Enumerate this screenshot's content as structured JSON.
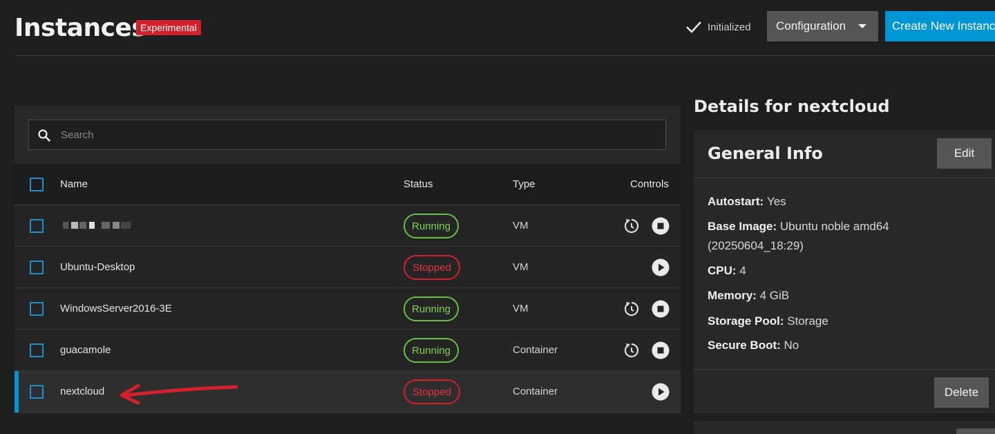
{
  "header": {
    "title": "Instances",
    "badge": "Experimental",
    "status": "Initialized",
    "config_button": "Configuration",
    "create_button": "Create New Instance"
  },
  "search": {
    "placeholder": "Search"
  },
  "table": {
    "columns": {
      "name": "Name",
      "status": "Status",
      "type": "Type",
      "controls": "Controls"
    },
    "rows": [
      {
        "name": "",
        "status": "Running",
        "type": "VM",
        "controls": [
          "restart",
          "stop"
        ],
        "name_obscured": true
      },
      {
        "name": "Ubuntu-Desktop",
        "status": "Stopped",
        "type": "VM",
        "controls": [
          "start"
        ]
      },
      {
        "name": "WindowsServer2016-3E",
        "status": "Running",
        "type": "VM",
        "controls": [
          "restart",
          "stop"
        ]
      },
      {
        "name": "guacamole",
        "status": "Running",
        "type": "Container",
        "controls": [
          "restart",
          "stop"
        ]
      },
      {
        "name": "nextcloud",
        "status": "Stopped",
        "type": "Container",
        "controls": [
          "start"
        ],
        "selected": true
      }
    ]
  },
  "details": {
    "title": "Details for nextcloud",
    "card_title": "General Info",
    "edit_button": "Edit",
    "delete_button": "Delete",
    "info": [
      {
        "label": "Autostart:",
        "value": "Yes"
      },
      {
        "label": "Base Image:",
        "value": "Ubuntu noble amd64"
      },
      {
        "label": "",
        "value": "(20250604_18:29)"
      },
      {
        "label": "CPU:",
        "value": "4"
      },
      {
        "label": "Memory:",
        "value": "4 GiB"
      },
      {
        "label": "Storage Pool:",
        "value": "Storage"
      },
      {
        "label": "Secure Boot:",
        "value": "No"
      }
    ]
  },
  "colors": {
    "accent": "#0095d5",
    "running": "#6abf45",
    "stopped": "#d3202a",
    "annotation_arrow": "#d3202a"
  }
}
